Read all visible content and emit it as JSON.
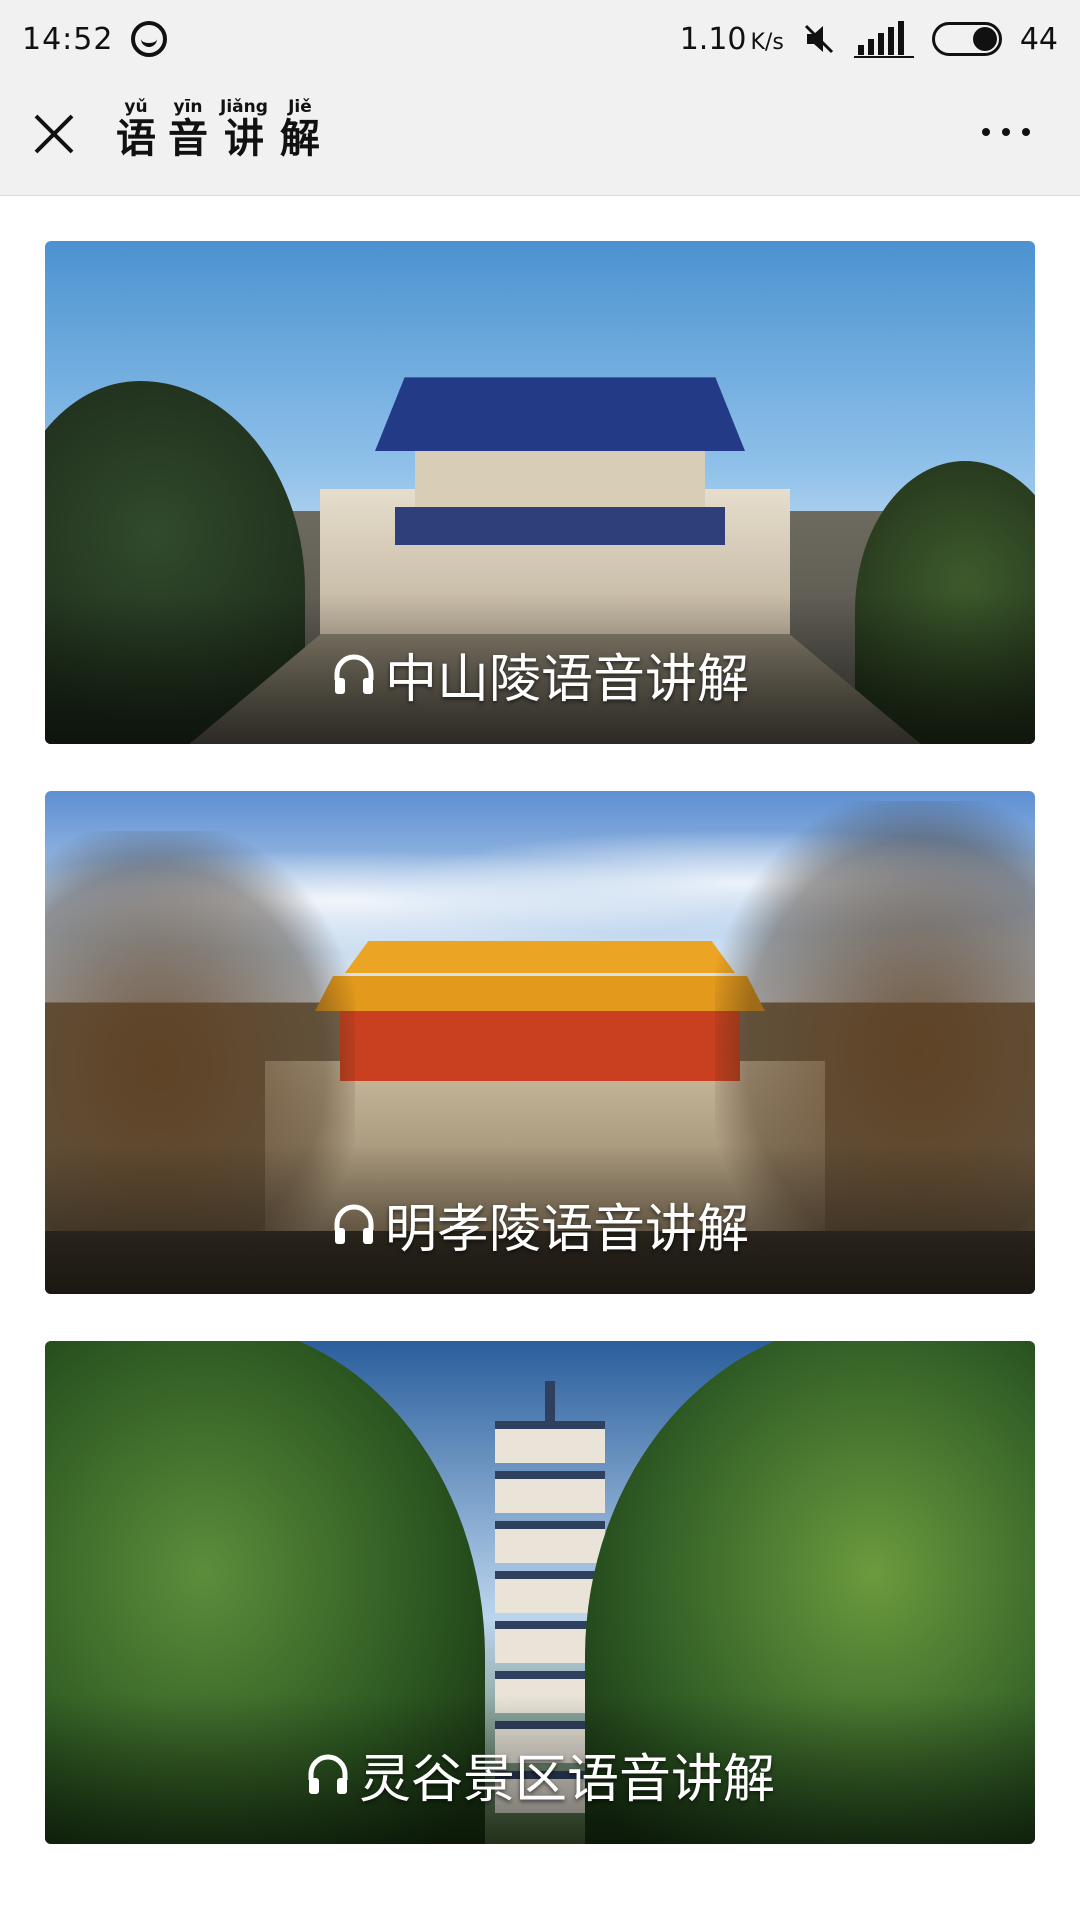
{
  "status_bar": {
    "time": "14:52",
    "speed_value": "1.10",
    "speed_unit": "K/s",
    "battery": "44",
    "icons": [
      "chat-bubble-icon",
      "mute-icon",
      "signal-icon",
      "battery-icon"
    ]
  },
  "header": {
    "title_chars": [
      {
        "pinyin": "yǔ",
        "hanzi": "语"
      },
      {
        "pinyin": "yīn",
        "hanzi": "音"
      },
      {
        "pinyin": "Jiǎng",
        "hanzi": "讲"
      },
      {
        "pinyin": "Jiě",
        "hanzi": "解"
      }
    ]
  },
  "cards": [
    {
      "label": "中山陵语音讲解",
      "icon": "headphones-icon"
    },
    {
      "label": "明孝陵语音讲解",
      "icon": "headphones-icon"
    },
    {
      "label": "灵谷景区语音讲解",
      "icon": "headphones-icon"
    }
  ],
  "colors": {
    "header_bg": "#f1f1f1",
    "label_text": "#ffffff"
  }
}
